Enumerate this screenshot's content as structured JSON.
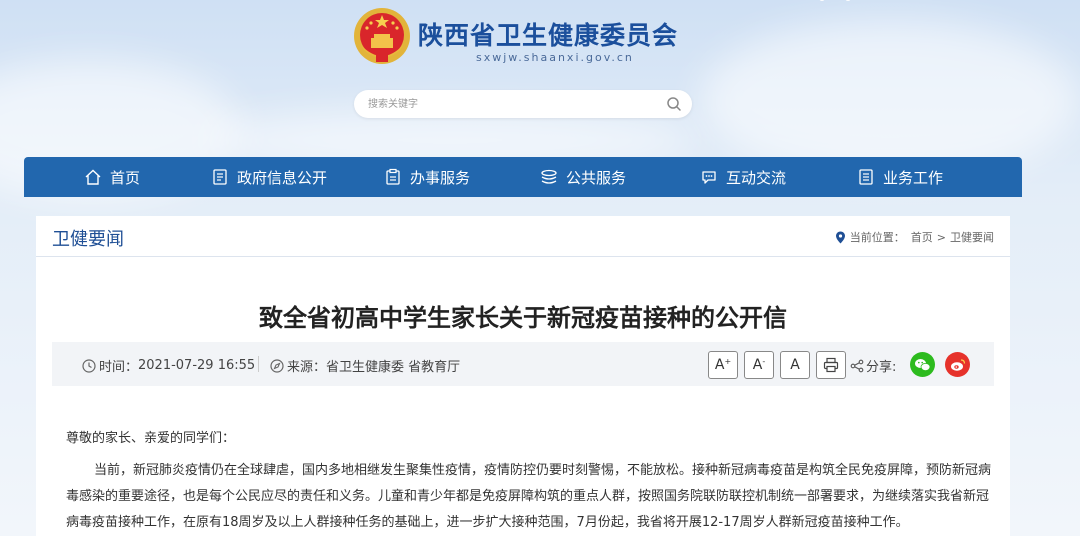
{
  "header": {
    "site_title": "陕西省卫生健康委员会",
    "site_url": "sxwjw.shaanxi.gov.cn",
    "search_placeholder": "搜索关键字"
  },
  "nav": {
    "items": [
      {
        "label": "首页",
        "icon": "home-icon"
      },
      {
        "label": "政府信息公开",
        "icon": "document-icon"
      },
      {
        "label": "办事服务",
        "icon": "clipboard-icon"
      },
      {
        "label": "公共服务",
        "icon": "layers-icon"
      },
      {
        "label": "互动交流",
        "icon": "chat-icon"
      },
      {
        "label": "业务工作",
        "icon": "list-icon"
      }
    ]
  },
  "section": {
    "title": "卫健要闻",
    "breadcrumb_prefix": "当前位置：",
    "breadcrumb": [
      "首页",
      "卫健要闻"
    ],
    "separator": ">"
  },
  "article": {
    "title": "致全省初高中学生家长关于新冠疫苗接种的公开信",
    "time_label": "时间：",
    "time_value": "2021-07-29 16:55",
    "source_label": "来源：",
    "source_value": "省卫生健康委 省教育厅",
    "font_large": "A",
    "font_medium": "A",
    "font_small": "A",
    "share_label": "分享:",
    "greeting": "尊敬的家长、亲爱的同学们：",
    "paragraph1": "当前，新冠肺炎疫情仍在全球肆虐，国内多地相继发生聚集性疫情，疫情防控仍要时刻警惕，不能放松。接种新冠病毒疫苗是构筑全民免疫屏障，预防新冠病毒感染的重要途径，也是每个公民应尽的责任和义务。儿童和青少年都是免疫屏障构筑的重点人群，按照国务院联防联控机制统一部署要求，为继续落实我省新冠病毒疫苗接种工作，在原有18周岁及以上人群接种任务的基础上，进一步扩大接种范围，7月份起，我省将开展12-17周岁人群新冠疫苗接种工作。"
  },
  "colors": {
    "nav_bg": "#2267ae",
    "title_blue": "#1b4f9c",
    "wechat_green": "#2dbb1e",
    "weibo_red": "#e6322b"
  }
}
